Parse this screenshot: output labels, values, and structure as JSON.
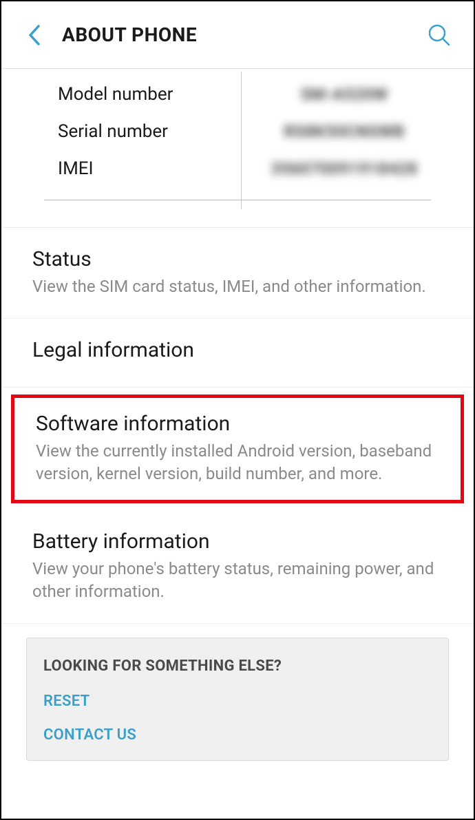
{
  "header": {
    "title": "ABOUT PHONE"
  },
  "device_info": {
    "model_label": "Model number",
    "model_value": "SM-A520W",
    "serial_label": "Serial number",
    "serial_value": "RS8K50CNSWB",
    "imei_label": "IMEI",
    "imei_value": "356070091918428"
  },
  "items": {
    "status": {
      "title": "Status",
      "sub": "View the SIM card status, IMEI, and other information."
    },
    "legal": {
      "title": "Legal information"
    },
    "software": {
      "title": "Software information",
      "sub": "View the currently installed Android version, baseband version, kernel version, build number, and more."
    },
    "battery": {
      "title": "Battery information",
      "sub": "View your phone's battery status, remaining power, and other information."
    }
  },
  "footer": {
    "title": "LOOKING FOR SOMETHING ELSE?",
    "reset": "RESET",
    "contact": "CONTACT US"
  }
}
